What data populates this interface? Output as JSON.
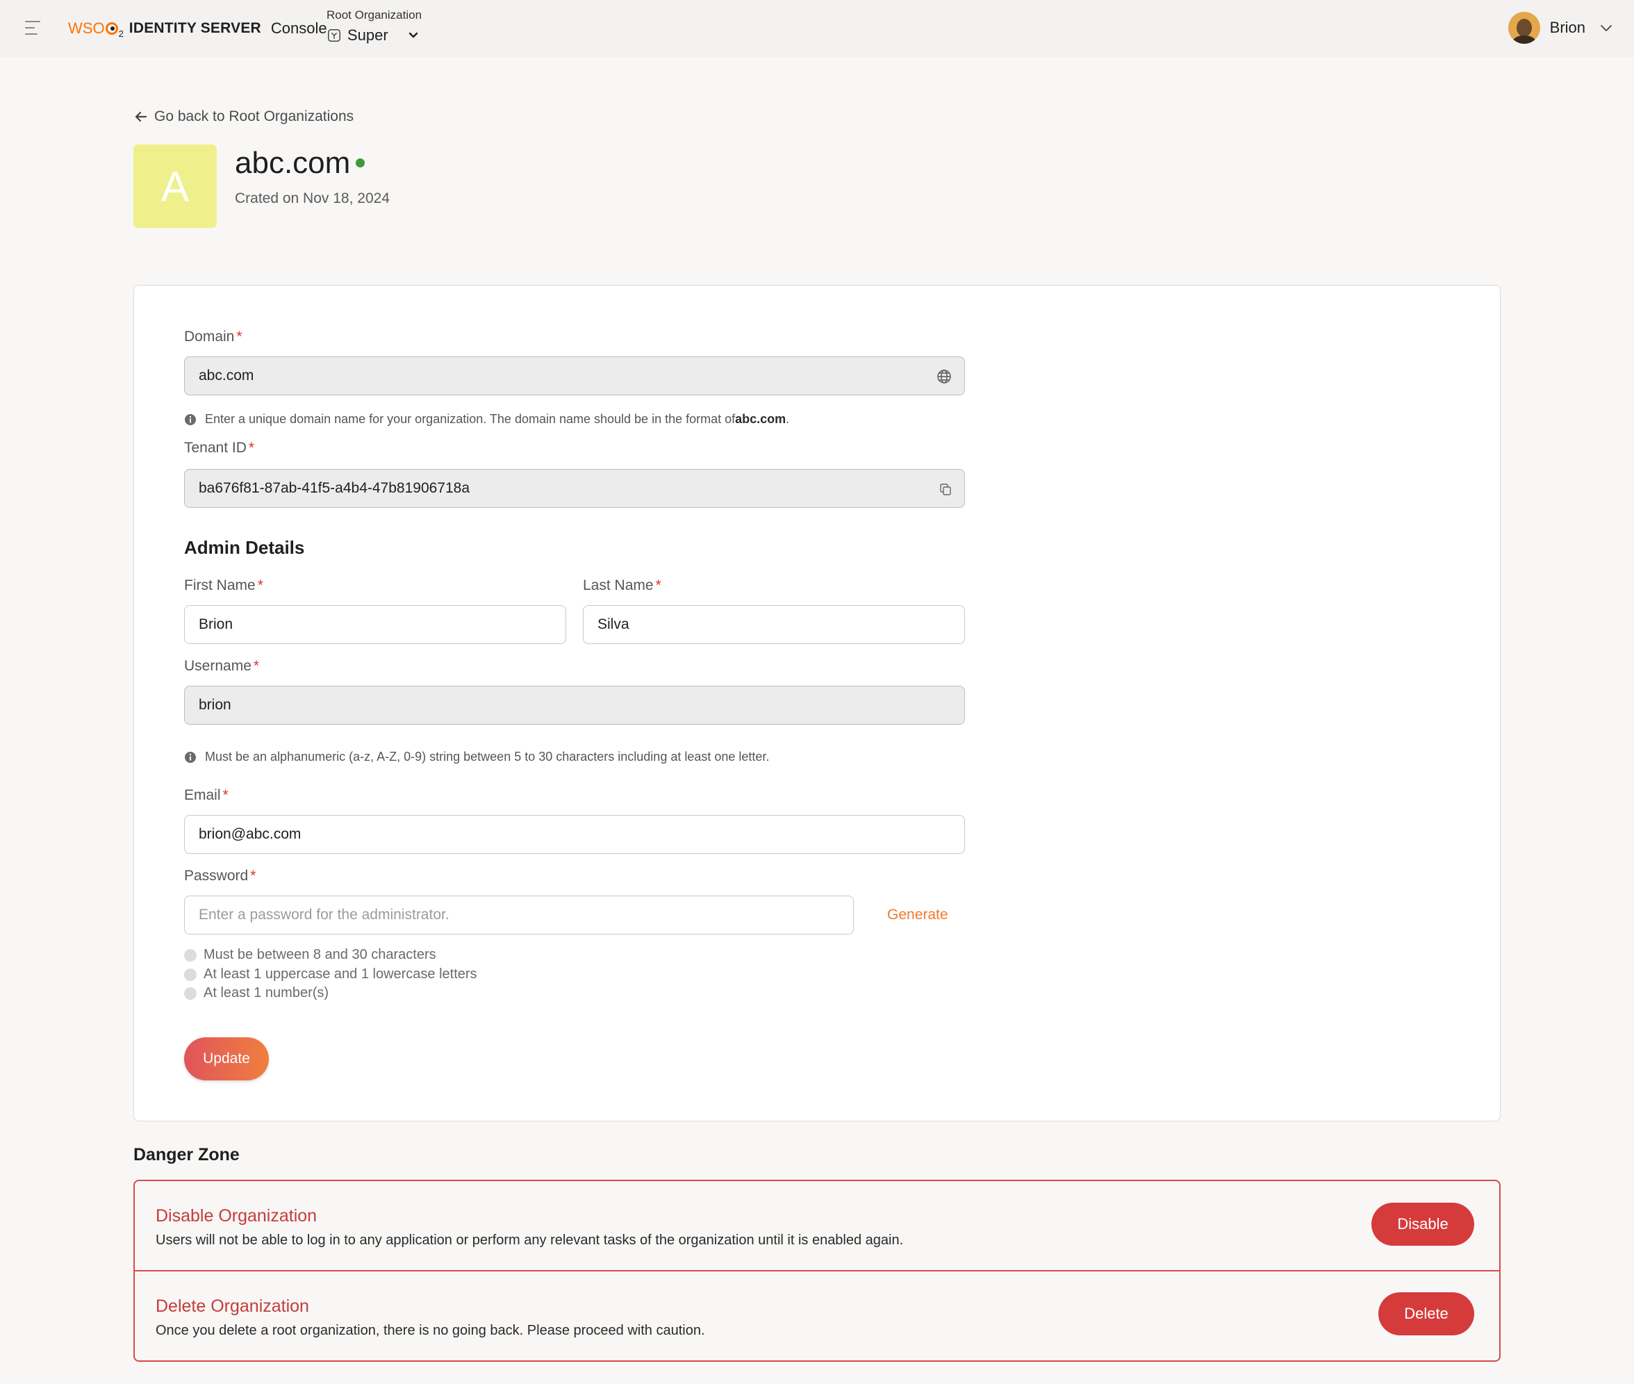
{
  "header": {
    "logo_brand": "WSO",
    "logo_brand_sub": "2",
    "product_name": "IDENTITY SERVER",
    "console_label": "Console",
    "org_switch_label": "Root Organization",
    "org_switch_value": "Super",
    "user_name": "Brion"
  },
  "page": {
    "back_link": "Go back to Root Organizations",
    "org_initial": "A",
    "org_name": "abc.com",
    "org_status_color": "#3d9a3d",
    "created_on": "Crated on Nov 18, 2024"
  },
  "form": {
    "domain": {
      "label": "Domain",
      "required": "*",
      "value": "abc.com",
      "icon": "globe-icon",
      "hint_prefix": "Enter a unique domain name for your organization. The domain name should be in the format of ",
      "hint_bold": "abc.com",
      "hint_suffix": "."
    },
    "tenant_id": {
      "label": "Tenant ID",
      "required": "*",
      "value": "ba676f81-87ab-41f5-a4b4-47b81906718a",
      "icon": "copy-icon"
    },
    "admin_section_title": "Admin Details",
    "first_name": {
      "label": "First Name",
      "required": "*",
      "value": "Brion"
    },
    "last_name": {
      "label": "Last Name",
      "required": "*",
      "value": "Silva"
    },
    "username": {
      "label": "Username",
      "required": "*",
      "value": "brion",
      "hint": "Must be an alphanumeric (a-z, A-Z, 0-9) string between 5 to 30 characters including at least one letter."
    },
    "email": {
      "label": "Email",
      "required": "*",
      "value": "brion@abc.com"
    },
    "password": {
      "label": "Password",
      "required": "*",
      "value": "",
      "placeholder": "Enter a password for the administrator.",
      "generate_label": "Generate",
      "rules": [
        "Must be between 8 and 30 characters",
        "At least 1 uppercase and 1 lowercase letters",
        "At least 1 number(s)"
      ]
    },
    "update_label": "Update"
  },
  "danger_zone": {
    "title": "Danger Zone",
    "border_color": "#d94a4a",
    "disable": {
      "title": "Disable Organization",
      "description": "Users will not be able to log in to any application or perform any relevant tasks of the organization until it is enabled again.",
      "button": "Disable"
    },
    "delete": {
      "title": "Delete Organization",
      "description": "Once you delete a root organization, there is no going back. Please proceed with caution.",
      "button": "Delete"
    }
  },
  "colors": {
    "accent": "#f07a2b",
    "danger": "#d63b3b",
    "org_avatar_bg": "#eff08c"
  }
}
